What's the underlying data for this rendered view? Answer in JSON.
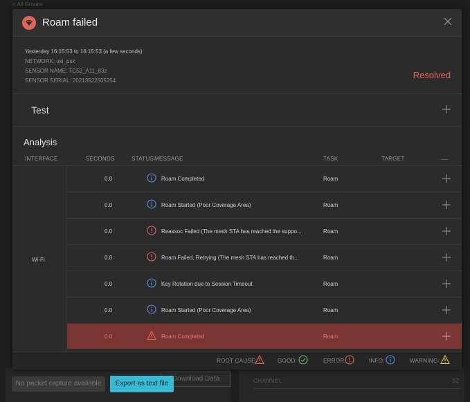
{
  "background": {
    "crumb": "< All Groups",
    "no_packet_label": "No packet capture available",
    "export_label": "Export as text file",
    "download_label": "Download Data",
    "channel_label": "CHANNEL",
    "channel_value": "52"
  },
  "modal": {
    "title": "Roam failed",
    "time_range": "Yesterday 16:15:53 to 16:15:53 (a few seconds)",
    "network": "NETWORK:  uxi_psk",
    "sensor_name": "SENSOR NAME:  TC52_A11_83z",
    "sensor_serial": "SENSOR SERIAL:  20213522505254",
    "status": "Resolved",
    "test_label": "Test",
    "analysis_title": "Analysis",
    "columns": {
      "interface": "INTERFACE",
      "seconds": "SECONDS",
      "status": "STATUS",
      "message": "MESSAGE",
      "task": "TASK",
      "target": "TARGET"
    },
    "interface": "Wi-Fi",
    "rows": [
      {
        "seconds": "0.0",
        "status": "info",
        "message": "Roam Completed",
        "task": "Roam",
        "target": ""
      },
      {
        "seconds": "0.0",
        "status": "info",
        "message": "Roam Started (Poor Coverage Area)",
        "task": "Roam",
        "target": ""
      },
      {
        "seconds": "0.0",
        "status": "error",
        "message": "Reassoc Failed (The mesh STA has reached the suppo...",
        "task": "Roam",
        "target": ""
      },
      {
        "seconds": "0.0",
        "status": "error",
        "message": "Roam Failed, Retrying (The mesh STA has reached th...",
        "task": "Roam",
        "target": ""
      },
      {
        "seconds": "0.0",
        "status": "info",
        "message": "Key Rotation due to Session Timeout",
        "task": "Roam",
        "target": ""
      },
      {
        "seconds": "0.0",
        "status": "info",
        "message": "Roam Started (Poor Coverage Area)",
        "task": "Roam",
        "target": ""
      },
      {
        "seconds": "0.0",
        "status": "root-cause",
        "message": "Roam Completed",
        "task": "Roam",
        "target": ""
      }
    ],
    "legend": {
      "root_cause": "ROOT CAUSE:",
      "good": "GOOD:",
      "error": "ERROR:",
      "info": "INFO:",
      "warning": "WARNING:"
    }
  },
  "colors": {
    "accent_red": "#e0665b",
    "info_blue": "#5b8fd9",
    "good_green": "#5fbf6a",
    "warning_yellow": "#e8c53a",
    "export_cyan": "#38b9d4",
    "highlight_row": "#7a3632"
  },
  "icons": {
    "logo": "aruba-logo-icon",
    "close": "close-icon",
    "expand": "plus-icon",
    "info": "info-circle-icon",
    "error": "error-circle-icon",
    "root_cause": "warning-triangle-icon",
    "good": "check-circle-icon",
    "warning": "warning-triangle-icon"
  }
}
